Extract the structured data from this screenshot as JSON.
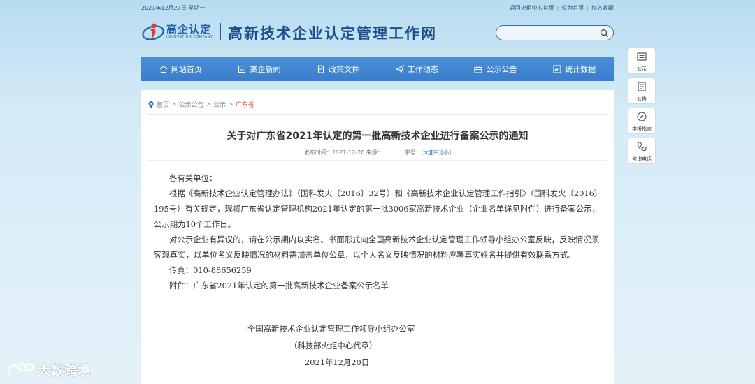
{
  "topbar": {
    "date": "2021年12月27日 星期一",
    "links": [
      "返回火炬中心首页",
      "设为首页",
      "加入收藏"
    ]
  },
  "logo": {
    "cn": "高企认定",
    "en": "INNOVATION COMPANY",
    "site_title": "高新技术企业认定管理工作网"
  },
  "search": {
    "placeholder": "",
    "icon": "search-icon"
  },
  "nav": [
    {
      "label": "网站首页",
      "icon": "home-icon"
    },
    {
      "label": "高企新闻",
      "icon": "news-icon"
    },
    {
      "label": "政策文件",
      "icon": "document-icon"
    },
    {
      "label": "工作动态",
      "icon": "paper-plane-icon"
    },
    {
      "label": "公示公告",
      "icon": "briefcase-icon"
    },
    {
      "label": "统计数据",
      "icon": "chart-icon"
    }
  ],
  "breadcrumb": {
    "items": [
      "首页",
      "公示公告",
      "公示"
    ],
    "current": "广东省"
  },
  "article": {
    "title": "关于对广东省2021年认定的第一批高新技术企业进行备案公示的通知",
    "meta_prefix": "发布时间：2021-12-20 来源：",
    "font_label": "字号：",
    "font_large": "[大]",
    "font_medium": "[中]",
    "font_small": "[小]",
    "salutation": "各有关单位：",
    "para1": "根据《高新技术企业认定管理办法》（国科发火〔2016〕32号）和《高新技术企业认定管理工作指引》（国科发火〔2016〕195号）有关规定，现将广东省认定管理机构2021年认定的第一批3006家高新技术企业（企业名单详见附件）进行备案公示，公示期为10个工作日。",
    "para2": "对公示企业有异议的，请在公示期内以实名、书面形式向全国高新技术企业认定管理工作领导小组办公室反映，反映情况须客观真实，以单位名义反映情况的材料需加盖单位公章，以个人名义反映情况的材料应署真实姓名并提供有效联系方式。",
    "fax": "传真：010-88656259",
    "attachment": "附件：广东省2021年认定的第一批高新技术企业备案公示名单",
    "sign_org": "全国高新技术企业认定管理工作领导小组办公室",
    "sign_sub": "（科技部火炬中心代章）",
    "sign_date": "2021年12月20日"
  },
  "side": [
    {
      "label": "公示",
      "icon": "notice-icon"
    },
    {
      "label": "公告",
      "icon": "bulletin-icon"
    },
    {
      "label": "申报指南",
      "icon": "compass-icon"
    },
    {
      "label": "咨询电话",
      "icon": "phone-icon"
    }
  ],
  "watermark": {
    "text": "大数跨境",
    "icon": "brand-logo-icon"
  },
  "colors": {
    "nav": "#3f85d0",
    "accent": "#1e4f8c",
    "active": "#d9534f"
  }
}
